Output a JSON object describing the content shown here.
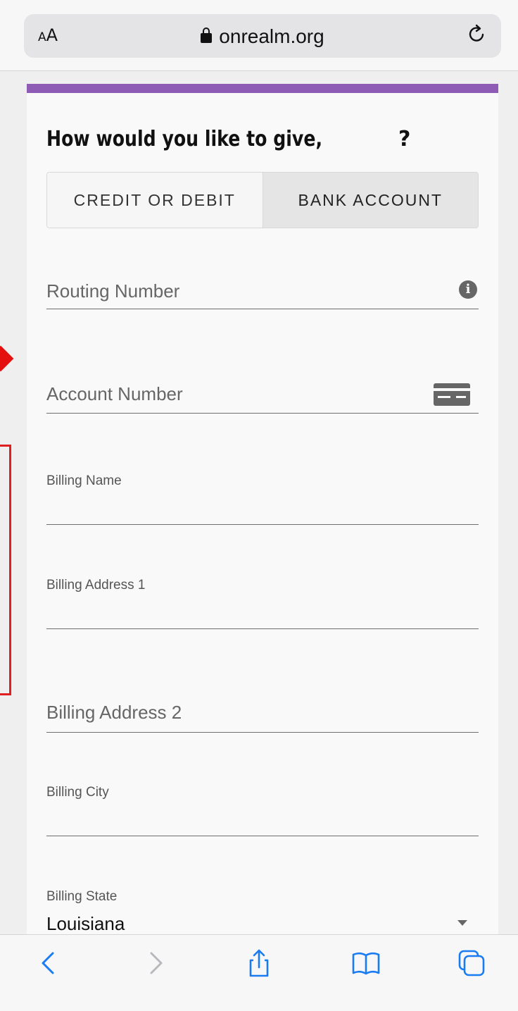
{
  "browser": {
    "text_size_label_small": "A",
    "text_size_label_large": "A",
    "domain": "onrealm.org"
  },
  "form": {
    "heading": "How would you like to give,",
    "heading_end": "?",
    "tabs": [
      {
        "label": "CREDIT OR DEBIT",
        "active": false
      },
      {
        "label": "BANK ACCOUNT",
        "active": true
      }
    ],
    "routing_placeholder": "Routing Number",
    "account_placeholder": "Account Number",
    "billing_name_label": "Billing Name",
    "billing_name_value": "",
    "billing_address1_label": "Billing Address 1",
    "billing_address1_value": "",
    "billing_address2_placeholder": "Billing Address 2",
    "billing_city_label": "Billing City",
    "billing_city_value": "",
    "billing_state_label": "Billing State",
    "billing_state_value": "Louisiana"
  },
  "colors": {
    "accent_bar": "#8e5bb5",
    "annotation_red": "#e41010",
    "ios_blue": "#1a7cf2"
  },
  "toolbar": {
    "icons": [
      "back-icon",
      "forward-icon",
      "share-icon",
      "bookmarks-icon",
      "tabs-icon"
    ]
  }
}
